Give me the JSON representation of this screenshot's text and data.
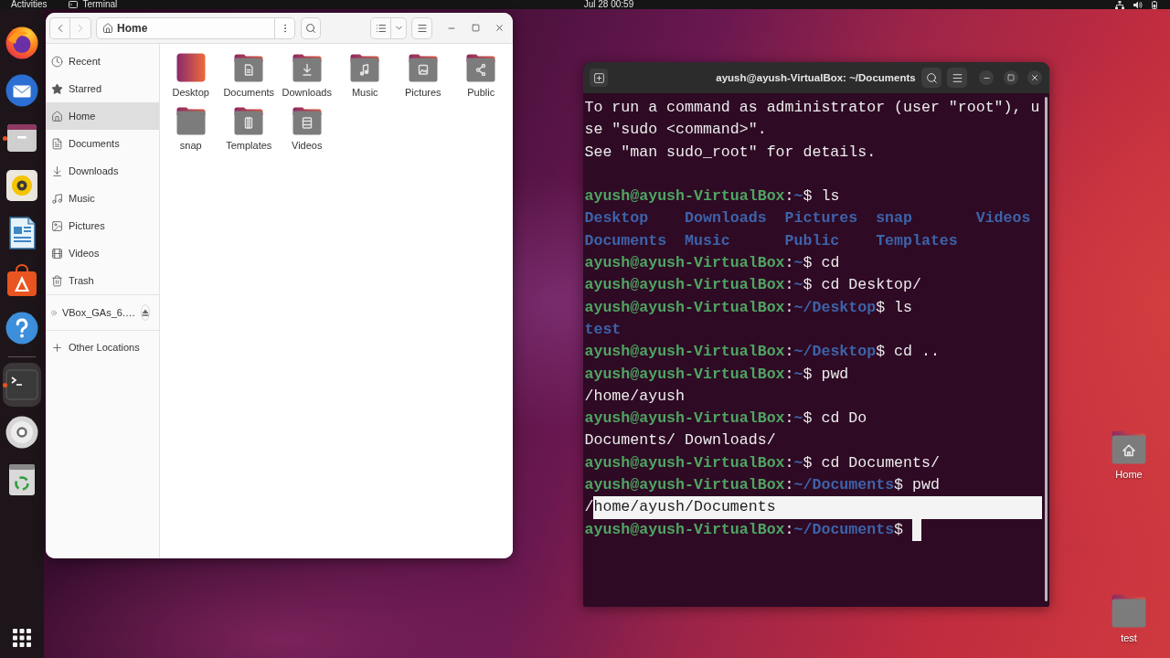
{
  "top_bar": {
    "activities": "Activities",
    "app_name": "Terminal",
    "clock": "Jul 28 00:59"
  },
  "dock": {
    "items": [
      {
        "kind": "browser",
        "running": false,
        "focused": false
      },
      {
        "kind": "mail",
        "running": false,
        "focused": false
      },
      {
        "kind": "files",
        "running": true,
        "focused": false
      },
      {
        "kind": "music",
        "running": false,
        "focused": false
      },
      {
        "kind": "writer",
        "running": false,
        "focused": false
      },
      {
        "kind": "store",
        "running": false,
        "focused": false
      },
      {
        "kind": "help",
        "running": false,
        "focused": false
      },
      {
        "kind": "separator"
      },
      {
        "kind": "terminal",
        "running": true,
        "focused": true
      },
      {
        "kind": "disc",
        "running": false,
        "focused": false
      },
      {
        "kind": "trash",
        "running": false,
        "focused": false
      }
    ]
  },
  "files": {
    "back_disabled": false,
    "forward_disabled": true,
    "location": "Home",
    "sidebar": [
      {
        "items": [
          {
            "kind": "recent",
            "label": "Recent",
            "selected": false
          },
          {
            "kind": "starred",
            "label": "Starred",
            "selected": false
          },
          {
            "kind": "home",
            "label": "Home",
            "selected": true
          },
          {
            "kind": "documents",
            "label": "Documents",
            "selected": false
          },
          {
            "kind": "downloads",
            "label": "Downloads",
            "selected": false
          },
          {
            "kind": "music",
            "label": "Music",
            "selected": false
          },
          {
            "kind": "pictures",
            "label": "Pictures",
            "selected": false
          },
          {
            "kind": "videos",
            "label": "Videos",
            "selected": false
          },
          {
            "kind": "trash",
            "label": "Trash",
            "selected": false
          }
        ]
      },
      {
        "items": [
          {
            "kind": "drive",
            "label": "VBox_GAs_6.…",
            "selected": false
          }
        ]
      },
      {
        "items": [
          {
            "kind": "other",
            "label": "Other Locations",
            "selected": false
          }
        ]
      }
    ],
    "folders": [
      {
        "kind": "desktop",
        "label": "Desktop"
      },
      {
        "kind": "documents",
        "label": "Documents"
      },
      {
        "kind": "downloads",
        "label": "Downloads"
      },
      {
        "kind": "music",
        "label": "Music"
      },
      {
        "kind": "pictures",
        "label": "Pictures"
      },
      {
        "kind": "public",
        "label": "Public"
      },
      {
        "kind": "plain",
        "label": "snap"
      },
      {
        "kind": "templates",
        "label": "Templates"
      },
      {
        "kind": "videos",
        "label": "Videos"
      }
    ]
  },
  "terminal": {
    "title": "ayush@ayush-VirtualBox: ~/Documents",
    "lines": [
      {
        "kind": "output",
        "text": "To run a command as administrator (user \"root\"), u"
      },
      {
        "kind": "output",
        "text": "se \"sudo <command>\"."
      },
      {
        "kind": "output",
        "text": "See \"man sudo_root\" for details."
      },
      {
        "kind": "blank"
      },
      {
        "kind": "prompt",
        "user": "ayush@ayush-VirtualBox",
        "separator": ":",
        "path": "~",
        "symbol": "$",
        "command": "ls",
        "cursor": false
      },
      {
        "kind": "listing",
        "items": [
          "Desktop",
          "Downloads",
          "Pictures",
          "snap",
          "Videos"
        ]
      },
      {
        "kind": "listing",
        "items": [
          "Documents",
          "Music",
          "Public",
          "Templates"
        ]
      },
      {
        "kind": "prompt",
        "user": "ayush@ayush-VirtualBox",
        "separator": ":",
        "path": "~",
        "symbol": "$",
        "command": "cd",
        "cursor": false
      },
      {
        "kind": "prompt",
        "user": "ayush@ayush-VirtualBox",
        "separator": ":",
        "path": "~",
        "symbol": "$",
        "command": "cd Desktop/",
        "cursor": false
      },
      {
        "kind": "prompt",
        "user": "ayush@ayush-VirtualBox",
        "separator": ":",
        "path": "~/Desktop",
        "symbol": "$",
        "command": "ls",
        "cursor": false
      },
      {
        "kind": "listing",
        "items": [
          "test"
        ]
      },
      {
        "kind": "prompt",
        "user": "ayush@ayush-VirtualBox",
        "separator": ":",
        "path": "~/Desktop",
        "symbol": "$",
        "command": "cd ..",
        "cursor": false
      },
      {
        "kind": "prompt",
        "user": "ayush@ayush-VirtualBox",
        "separator": ":",
        "path": "~",
        "symbol": "$",
        "command": "pwd",
        "cursor": false
      },
      {
        "kind": "output",
        "text": "/home/ayush"
      },
      {
        "kind": "prompt",
        "user": "ayush@ayush-VirtualBox",
        "separator": ":",
        "path": "~",
        "symbol": "$",
        "command": "cd Do",
        "cursor": false
      },
      {
        "kind": "output",
        "text": "Documents/ Downloads/"
      },
      {
        "kind": "prompt",
        "user": "ayush@ayush-VirtualBox",
        "separator": ":",
        "path": "~",
        "symbol": "$",
        "command": "cd Documents/",
        "cursor": false
      },
      {
        "kind": "prompt",
        "user": "ayush@ayush-VirtualBox",
        "separator": ":",
        "path": "~/Documents",
        "symbol": "$",
        "command": "pwd",
        "cursor": false
      },
      {
        "kind": "output",
        "text": "/",
        "selected_text": "home/ayush/Documents"
      },
      {
        "kind": "prompt",
        "user": "ayush@ayush-VirtualBox",
        "separator": ":",
        "path": "~/Documents",
        "symbol": "$",
        "cursor": true
      }
    ]
  },
  "desktop_icons": [
    {
      "kind": "home",
      "label": "Home"
    },
    {
      "kind": "plain",
      "label": "test"
    }
  ]
}
